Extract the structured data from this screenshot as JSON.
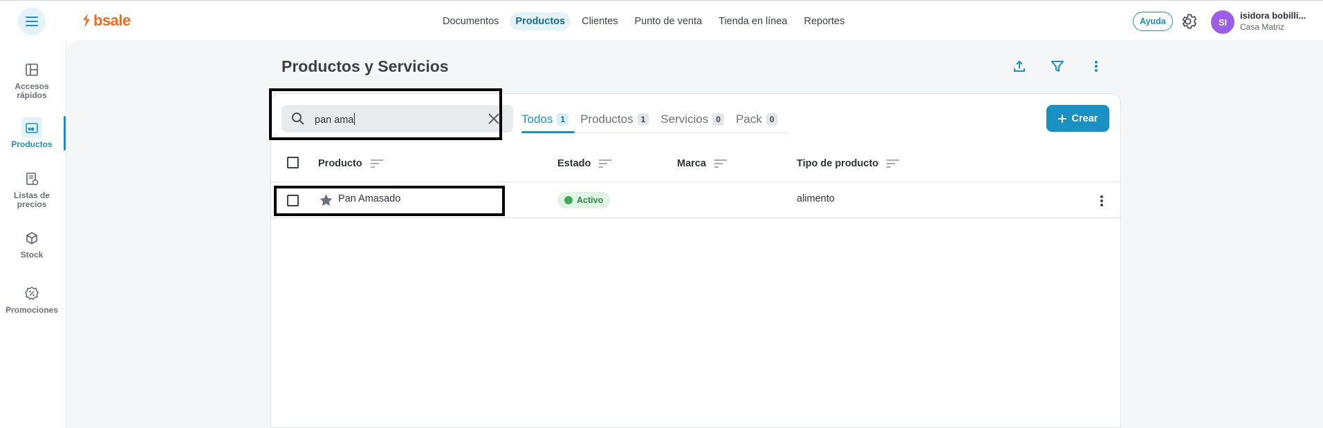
{
  "app": {
    "logo_text": "bsale",
    "brand_color": "#f26b1d",
    "accent_color": "#1a91c2"
  },
  "topnav": {
    "items": [
      {
        "label": "Documentos",
        "active": false
      },
      {
        "label": "Productos",
        "active": true
      },
      {
        "label": "Clientes",
        "active": false
      },
      {
        "label": "Punto de venta",
        "active": false
      },
      {
        "label": "Tienda en línea",
        "active": false
      },
      {
        "label": "Reportes",
        "active": false
      }
    ],
    "help_label": "Ayuda",
    "settings_icon": "gear-icon"
  },
  "user": {
    "initials": "SI",
    "name": "isidora bobilli...",
    "branch": "Casa Matriz"
  },
  "sidebar": {
    "items": [
      {
        "label": "Accesos rápidos",
        "icon": "dashboard-icon",
        "active": false
      },
      {
        "label": "Productos",
        "icon": "products-icon",
        "active": true
      },
      {
        "label": "Listas de precios",
        "icon": "price-list-icon",
        "active": false
      },
      {
        "label": "Stock",
        "icon": "box-icon",
        "active": false
      },
      {
        "label": "Promociones",
        "icon": "promotions-icon",
        "active": false
      }
    ]
  },
  "page": {
    "title": "Productos y Servicios"
  },
  "search": {
    "value": "pan ama",
    "icon": "search-icon",
    "clear_icon": "close-icon"
  },
  "tabs": [
    {
      "label": "Todos",
      "count": "1",
      "active": true
    },
    {
      "label": "Productos",
      "count": "1",
      "active": false
    },
    {
      "label": "Servicios",
      "count": "0",
      "active": false
    },
    {
      "label": "Pack",
      "count": "0",
      "active": false
    }
  ],
  "create_button": {
    "label": "Crear"
  },
  "table": {
    "columns": [
      "Producto",
      "Estado",
      "Marca",
      "Tipo de producto"
    ],
    "rows": [
      {
        "producto": "Pan Amasado",
        "estado": "Activo",
        "marca": "",
        "tipo": "alimento"
      }
    ]
  }
}
